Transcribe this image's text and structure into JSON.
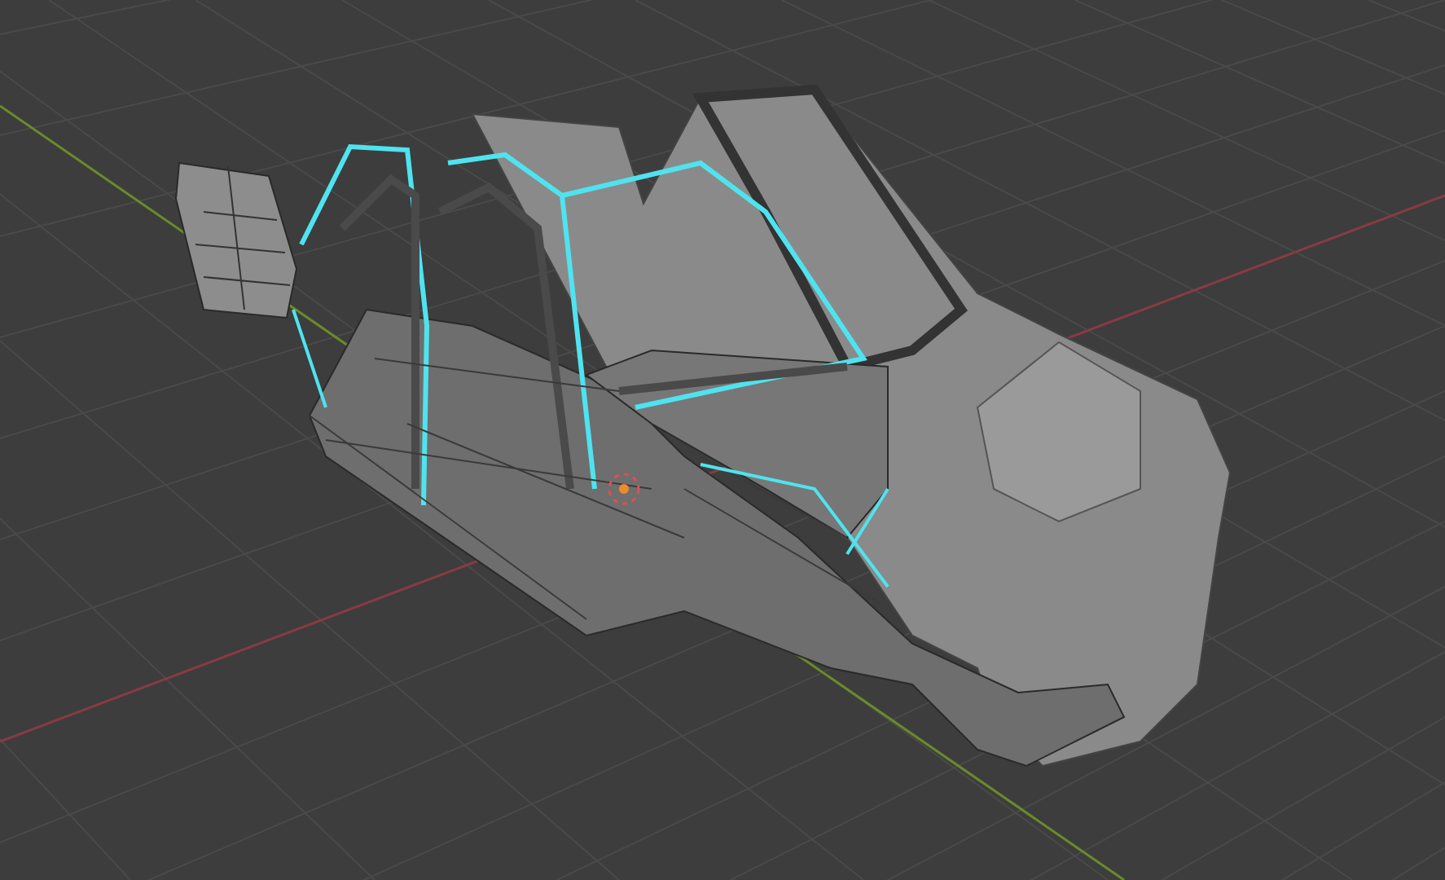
{
  "viewport": {
    "show_grid": true,
    "show_axes": true,
    "show_origin": true
  }
}
